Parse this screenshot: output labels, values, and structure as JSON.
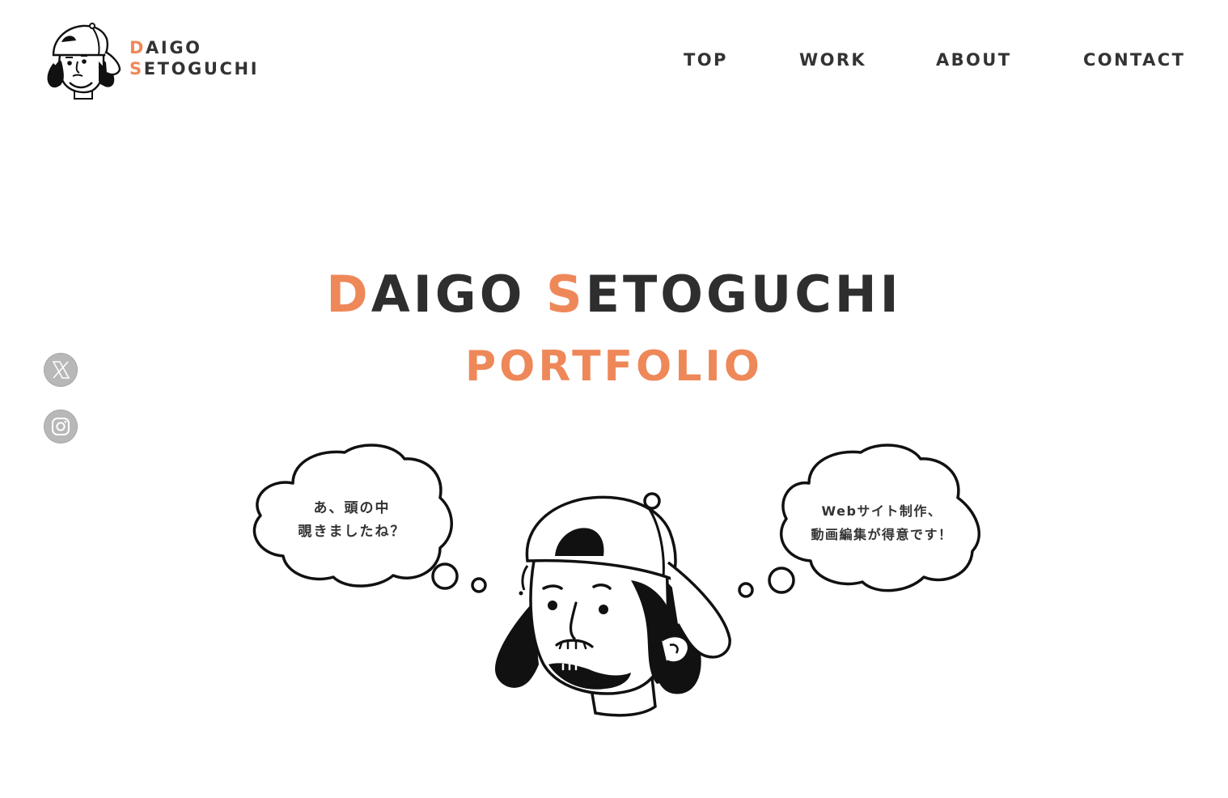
{
  "header": {
    "logo": {
      "line1_initial": "D",
      "line1_rest": "AIGO",
      "line2_initial": "S",
      "line2_rest": "ETOGUCHI"
    },
    "nav": [
      {
        "label": "TOP"
      },
      {
        "label": "WORK"
      },
      {
        "label": "ABOUT"
      },
      {
        "label": "CONTACT"
      }
    ]
  },
  "social": [
    {
      "icon": "x-icon"
    },
    {
      "icon": "instagram-icon"
    }
  ],
  "hero": {
    "title_first_initial": "D",
    "title_first_rest": "AIGO",
    "title_last_initial": "S",
    "title_last_rest": "ETOGUCHI",
    "subtitle": "PORTFOLIO"
  },
  "illustration": {
    "bubble_left": [
      "あ、頭の中",
      "覗きましたね？"
    ],
    "bubble_right": [
      "Webサイト制作、",
      "動画編集が得意です！"
    ]
  },
  "colors": {
    "accent": "#ee8859",
    "text": "#333333",
    "social_bg": "#b8b8b8"
  }
}
